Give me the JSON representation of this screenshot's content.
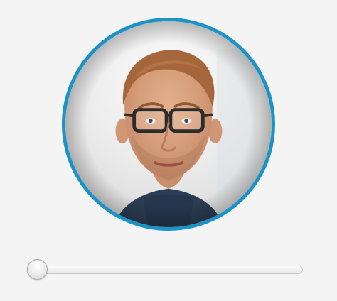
{
  "profile": {
    "photo": {
      "icon": "person-portrait",
      "accent_ring_color": "#1a93c9"
    }
  },
  "slider": {
    "value": 0.0
  }
}
